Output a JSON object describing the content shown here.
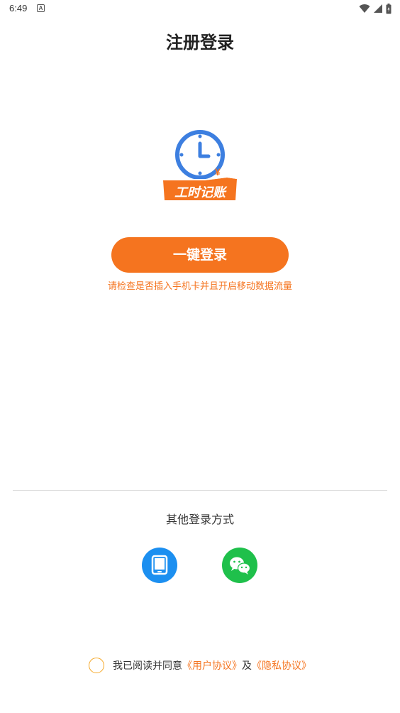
{
  "status_bar": {
    "time": "6:49",
    "notification_icon": "A"
  },
  "page": {
    "title": "注册登录"
  },
  "logo": {
    "text": "工时记账",
    "currency_symbol": "¥"
  },
  "login": {
    "button_label": "一键登录",
    "hint": "请检查是否插入手机卡并且开启移动数据流量"
  },
  "other_login": {
    "title": "其他登录方式",
    "options": [
      {
        "name": "phone",
        "icon": "tablet-icon"
      },
      {
        "name": "wechat",
        "icon": "wechat-icon"
      }
    ]
  },
  "agreement": {
    "prefix": "我已阅读并同意",
    "user_agreement": "《用户协议》",
    "conjunction": "及",
    "privacy_policy": "《隐私协议》"
  },
  "colors": {
    "accent": "#f5741f",
    "phone_blue": "#1c8ff0",
    "wechat_green": "#1fc04b",
    "logo_blue": "#3d7fe0"
  }
}
